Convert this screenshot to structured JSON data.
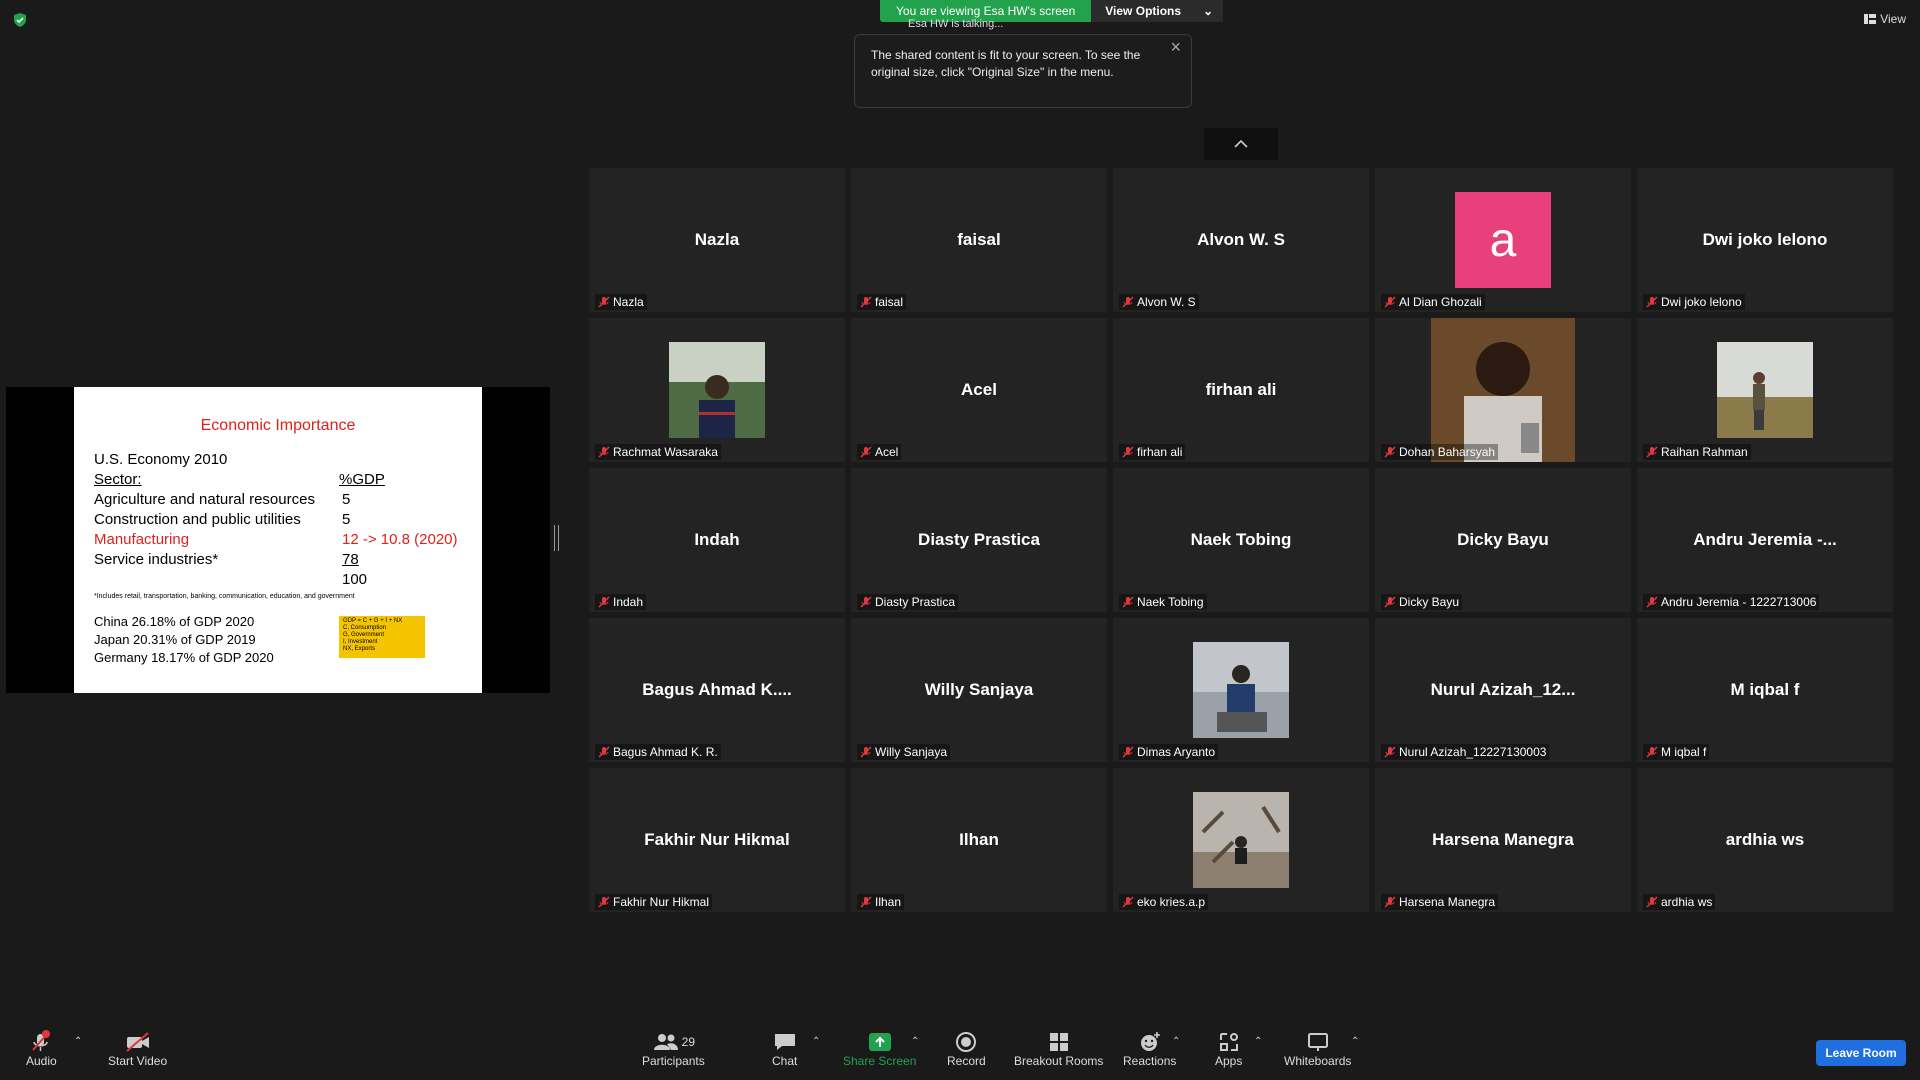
{
  "banner": {
    "viewing": "You are viewing Esa HW's screen",
    "options": "View Options",
    "talking": "Esa HW is talking..."
  },
  "tooltip": {
    "text": "The shared content is fit to your screen. To see the original size, click \"Original Size\" in the menu."
  },
  "view_label": "View",
  "slide": {
    "title": "Economic Importance",
    "heading": "U.S. Economy 2010",
    "sector_label": "Sector:",
    "gdp_label": "%GDP",
    "rows": [
      {
        "sector": "Agriculture and natural resources",
        "value": "5"
      },
      {
        "sector": "Construction and public utilities",
        "value": "5"
      },
      {
        "sector": "Manufacturing",
        "value": "12 -> 10.8 (2020)"
      },
      {
        "sector": "Service industries*",
        "value": "78"
      }
    ],
    "total": "100",
    "footnote": "*Includes retail, transportation, banking, communication, education, and government",
    "countries": [
      "China 26.18% of GDP 2020",
      "Japan  20.31% of GDP 2019",
      "Germany 18.17% of GDP 2020"
    ],
    "box": [
      "GDP = C + G + I + NX",
      "C, Consumption",
      "G, Government",
      "I, Investment",
      "NX, Exports"
    ]
  },
  "participants": [
    {
      "display": "Nazla",
      "label": "Nazla"
    },
    {
      "display": "faisal",
      "label": "faisal"
    },
    {
      "display": "Alvon W. S",
      "label": "Alvon W. S"
    },
    {
      "display": "a",
      "label": "Al Dian Ghozali",
      "avatar": "#e8407a"
    },
    {
      "display": "Dwi joko lelono",
      "label": "Dwi joko lelono"
    },
    {
      "display": "",
      "label": "Rachmat Wasaraka",
      "photo": "photo-rachmat"
    },
    {
      "display": "Acel",
      "label": "Acel"
    },
    {
      "display": "firhan ali",
      "label": "firhan ali"
    },
    {
      "display": "",
      "label": "Dohan Baharsyah",
      "photo": "photo-dohan"
    },
    {
      "display": "",
      "label": "Raihan Rahman",
      "photo": "photo-raihan"
    },
    {
      "display": "Indah",
      "label": "Indah"
    },
    {
      "display": "Diasty Prastica",
      "label": "Diasty Prastica"
    },
    {
      "display": "Naek Tobing",
      "label": "Naek Tobing"
    },
    {
      "display": "Dicky Bayu",
      "label": "Dicky Bayu"
    },
    {
      "display": "Andru Jeremia -...",
      "label": "Andru Jeremia - 1222713006"
    },
    {
      "display": "Bagus Ahmad K....",
      "label": "Bagus Ahmad K. R."
    },
    {
      "display": "Willy Sanjaya",
      "label": "Willy Sanjaya"
    },
    {
      "display": "",
      "label": "Dimas Aryanto",
      "photo": "photo-dimas"
    },
    {
      "display": "Nurul Azizah_12...",
      "label": "Nurul Azizah_12227130003"
    },
    {
      "display": "M iqbal f",
      "label": "M iqbal f"
    },
    {
      "display": "Fakhir Nur Hikmal",
      "label": "Fakhir Nur Hikmal"
    },
    {
      "display": "Ilhan",
      "label": "Ilhan"
    },
    {
      "display": "",
      "label": "eko kries.a.p",
      "photo": "photo-eko"
    },
    {
      "display": "Harsena Manegra",
      "label": "Harsena Manegra"
    },
    {
      "display": "ardhia ws",
      "label": "ardhia ws"
    }
  ],
  "toolbar": {
    "audio": "Audio",
    "start_video": "Start Video",
    "participants": "Participants",
    "participant_count": "29",
    "chat": "Chat",
    "share_screen": "Share Screen",
    "record": "Record",
    "breakout": "Breakout Rooms",
    "reactions": "Reactions",
    "apps": "Apps",
    "whiteboards": "Whiteboards",
    "leave": "Leave Room"
  },
  "colors": {
    "share_green": "#23a24d",
    "leave_blue": "#1f6fe0",
    "muted_red": "#e0383e",
    "slide_red": "#e0201b",
    "box_yellow": "#f5c400"
  }
}
